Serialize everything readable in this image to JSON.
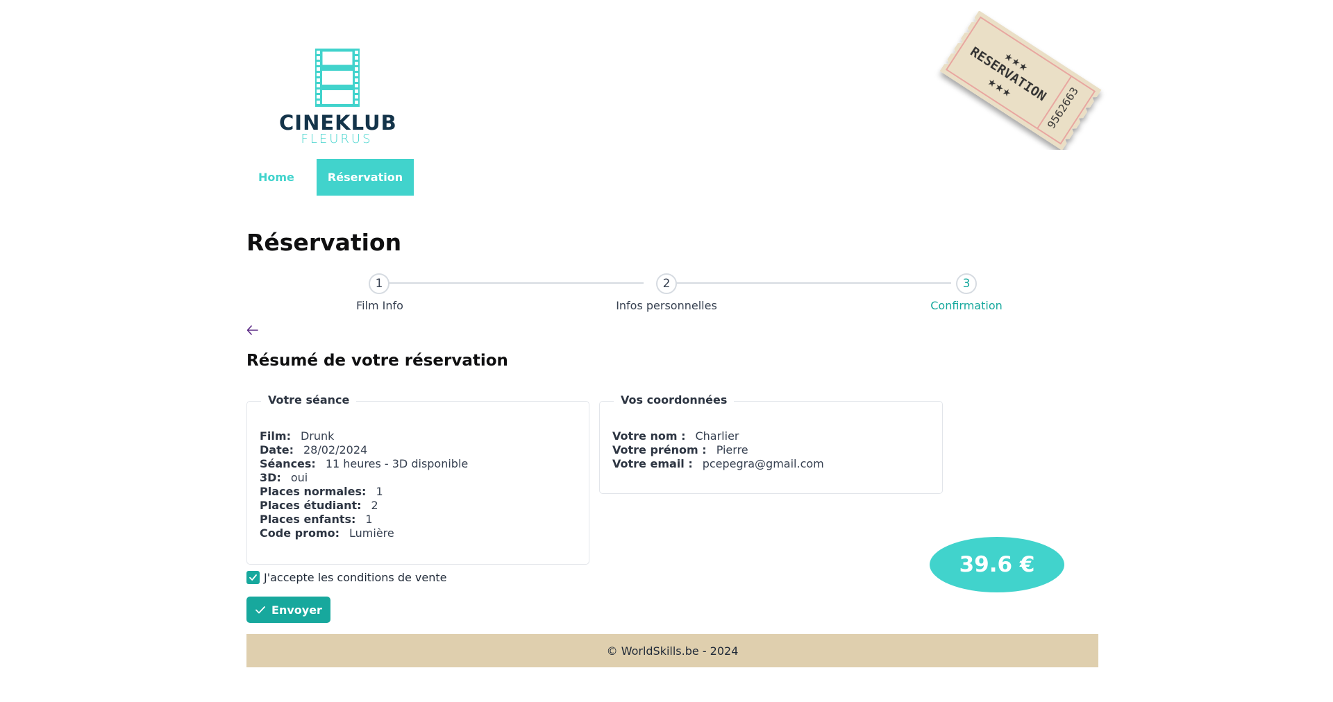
{
  "brand": {
    "name": "CINEKLUB",
    "city": "FLEURUS",
    "accent": "#41d3cc",
    "dark": "#14344a"
  },
  "ticket": {
    "text": "RESERVATION",
    "number": "9562663",
    "stars": "★★★"
  },
  "nav": {
    "items": [
      {
        "label": "Home"
      },
      {
        "label": "Réservation"
      }
    ]
  },
  "page": {
    "title": "Réservation"
  },
  "stepper": {
    "steps": [
      {
        "number": "1",
        "label": "Film Info"
      },
      {
        "number": "2",
        "label": "Infos personnelles"
      },
      {
        "number": "3",
        "label": "Confirmation"
      }
    ],
    "current": 3
  },
  "summary": {
    "title": "Résumé de votre réservation",
    "seance": {
      "legend": "Votre séance",
      "rows": [
        {
          "label": "Film:",
          "value": "Drunk"
        },
        {
          "label": "Date:",
          "value": "28/02/2024"
        },
        {
          "label": "Séances:",
          "value": "11 heures - 3D disponible"
        },
        {
          "label": "3D:",
          "value": "oui"
        },
        {
          "label": "Places normales:",
          "value": "1"
        },
        {
          "label": "Places étudiant:",
          "value": "2"
        },
        {
          "label": "Places enfants:",
          "value": "1"
        },
        {
          "label": "Code promo:",
          "value": "Lumière"
        }
      ]
    },
    "coordonnees": {
      "legend": "Vos coordonnées",
      "rows": [
        {
          "label": "Votre nom :",
          "value": "Charlier"
        },
        {
          "label": "Votre prénom :",
          "value": "Pierre"
        },
        {
          "label": "Votre email :",
          "value": "pcepegra@gmail.com"
        }
      ]
    }
  },
  "price": {
    "value": "39.6 €"
  },
  "terms": {
    "label": "J'accepte les conditions de vente",
    "checked": true
  },
  "submit": {
    "label": "Envoyer"
  },
  "footer": {
    "text": "© WorldSkills.be - 2024"
  }
}
